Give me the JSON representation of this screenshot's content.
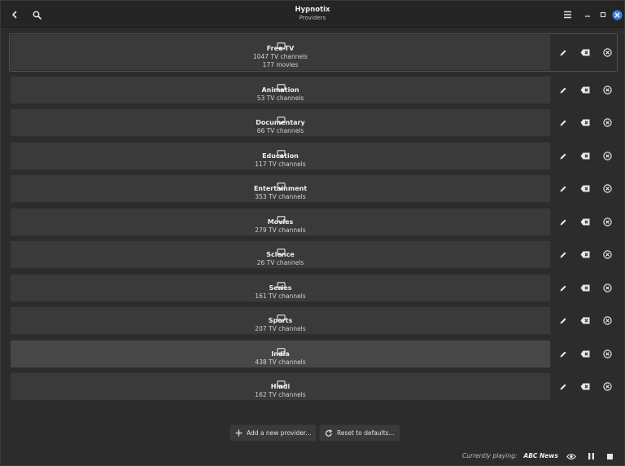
{
  "window": {
    "title": "Hypnotix",
    "subtitle": "Providers"
  },
  "header": {
    "back_icon": "back-arrow-icon",
    "search_icon": "search-icon",
    "menu_icon": "hamburger-menu-icon",
    "minimize_icon": "minimize-icon",
    "maximize_icon": "maximize-icon",
    "close_icon": "close-icon",
    "close_color": "#3584e4"
  },
  "providers": [
    {
      "name": "Free-TV",
      "channels": "1047 TV channels",
      "movies": "177 movies"
    },
    {
      "name": "Animation",
      "channels": "53 TV channels"
    },
    {
      "name": "Documentary",
      "channels": "66 TV channels"
    },
    {
      "name": "Education",
      "channels": "117 TV channels"
    },
    {
      "name": "Entertainment",
      "channels": "353 TV channels"
    },
    {
      "name": "Movies",
      "channels": "279 TV channels"
    },
    {
      "name": "Science",
      "channels": "26 TV channels"
    },
    {
      "name": "Series",
      "channels": "161 TV channels"
    },
    {
      "name": "Sports",
      "channels": "207 TV channels"
    },
    {
      "name": "India",
      "channels": "438 TV channels"
    },
    {
      "name": "Hindi",
      "channels": "162 TV channels"
    }
  ],
  "row_actions": {
    "edit_icon": "pencil-icon",
    "clear_icon": "backspace-clear-icon",
    "remove_icon": "circle-x-remove-icon"
  },
  "footer": {
    "add_label": "Add a new provider...",
    "reset_label": "Reset to defaults..."
  },
  "status": {
    "label": "Currently playing:",
    "value": "ABC News"
  }
}
